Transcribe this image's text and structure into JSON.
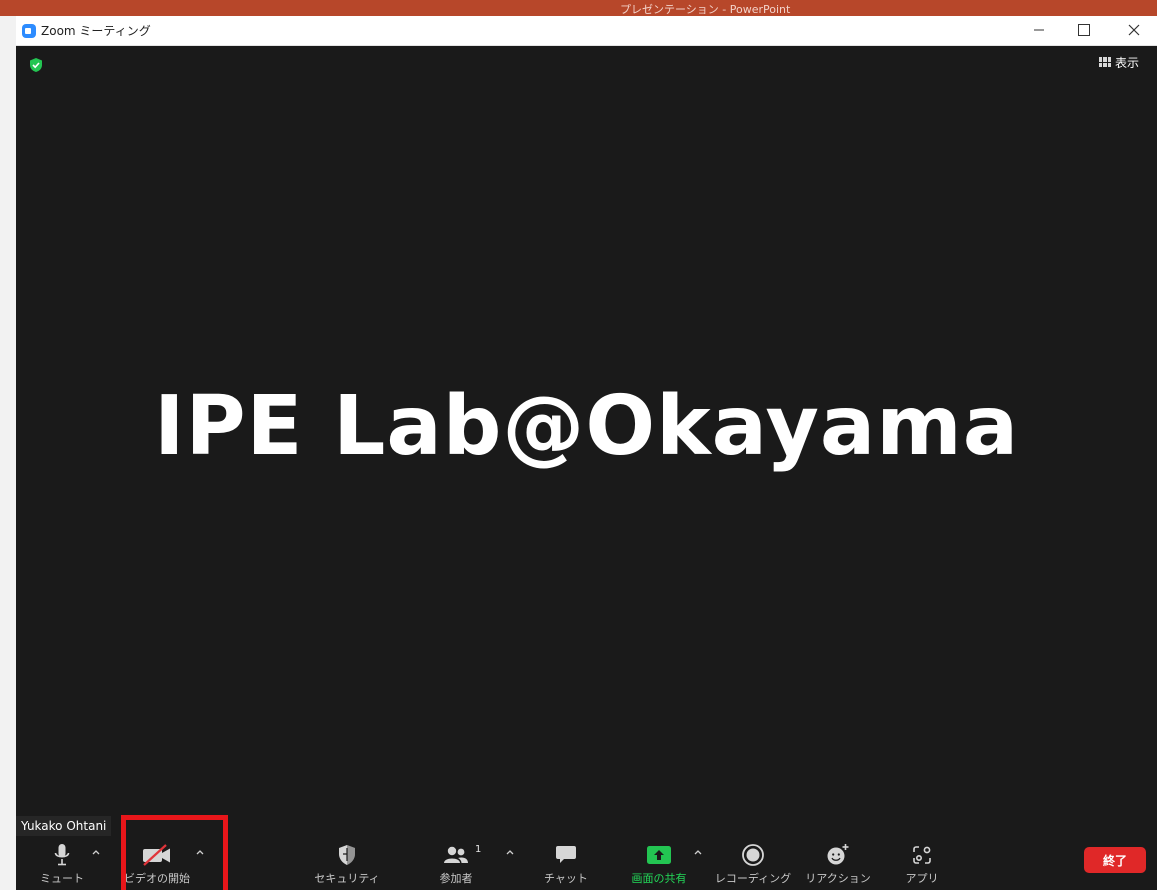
{
  "window": {
    "title": "Zoom ミーティング",
    "background_title": "プレゼンテーション - PowerPoint",
    "view_label": "表示"
  },
  "meeting": {
    "display_text": "IPE Lab@Okayama",
    "participant_name": "Yukako Ohtani",
    "participant_count": "1"
  },
  "toolbar": {
    "items": [
      {
        "label": "ミュート",
        "icon": "microphone-icon"
      },
      {
        "label": "ビデオの開始",
        "icon": "video-off-icon"
      },
      {
        "label": "セキュリティ",
        "icon": "shield-icon"
      },
      {
        "label": "参加者",
        "icon": "participants-icon"
      },
      {
        "label": "チャット",
        "icon": "chat-icon"
      },
      {
        "label": "画面の共有",
        "icon": "share-screen-icon"
      },
      {
        "label": "レコーディング",
        "icon": "record-icon"
      },
      {
        "label": "リアクション",
        "icon": "reaction-icon"
      },
      {
        "label": "アプリ",
        "icon": "apps-icon"
      }
    ],
    "end_label": "終了"
  },
  "colors": {
    "meeting_bg": "#1a1a1a",
    "share_green": "#23d959",
    "end_red": "#e02828",
    "highlight_red": "#e8161a",
    "zoom_blue": "#2d8cff"
  }
}
